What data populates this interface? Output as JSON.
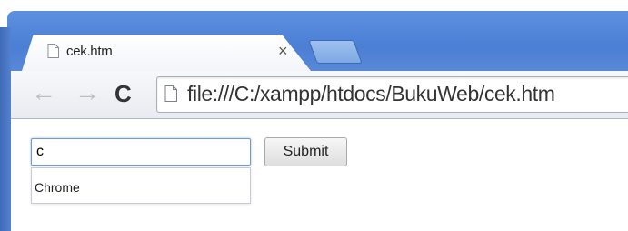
{
  "browser": {
    "tab": {
      "title": "cek.htm",
      "close_symbol": "×"
    },
    "toolbar": {
      "back_symbol": "←",
      "forward_symbol": "→",
      "reload_symbol": "C",
      "url": "file:///C:/xampp/htdocs/BukuWeb/cek.htm"
    },
    "icons": {
      "tab_page_icon": "page-icon",
      "omnibox_page_icon": "page-icon",
      "new_tab": "new-tab-icon"
    }
  },
  "form": {
    "input_value": "c",
    "submit_label": "Submit",
    "autocomplete": {
      "suggestions": [
        "Chrome"
      ]
    }
  },
  "colors": {
    "frame_blue": "#4b7fd4",
    "focus_border": "#6f9bd6"
  }
}
